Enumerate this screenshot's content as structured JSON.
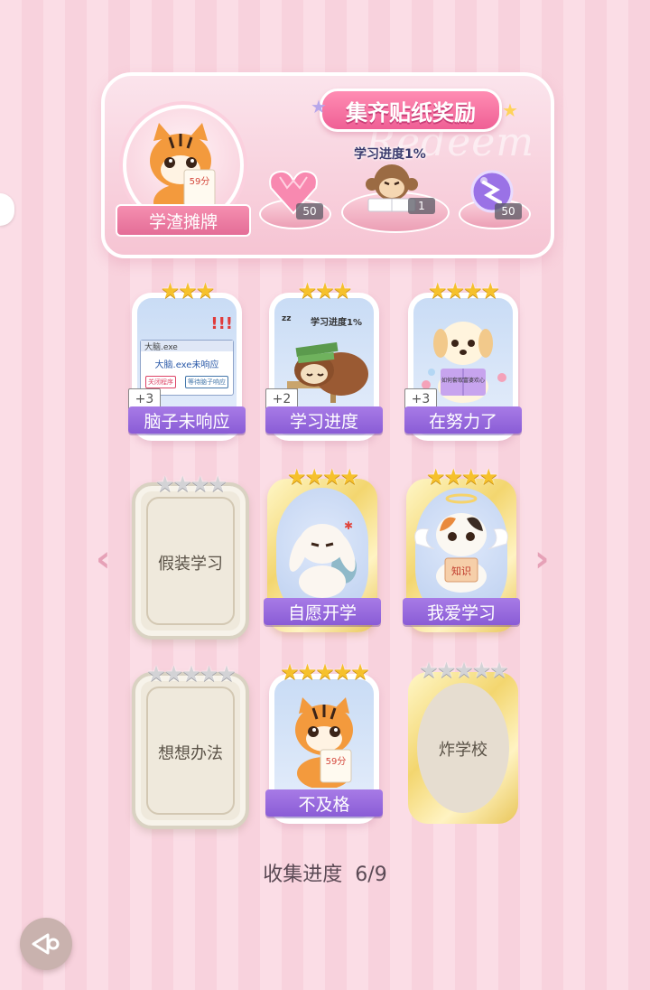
{
  "banner": {
    "title": "集齐贴纸奖励",
    "watermark": "Redeem",
    "avatar_label": "学渣摊牌",
    "avatar_paper": "59分",
    "study_label": "学习进度1%",
    "rewards": [
      {
        "name": "heart-gem",
        "qty": "50"
      },
      {
        "name": "monkey-sticker",
        "qty": "1"
      },
      {
        "name": "purple-orb",
        "qty": "50"
      }
    ]
  },
  "cards": [
    {
      "id": "c1",
      "name": "脑子未响应",
      "stars": 3,
      "filled": 3,
      "bonus": "+3",
      "state": "unlocked",
      "popup_title": "大脑.exe",
      "popup_text": "大脑.exe未响应",
      "popup_btn1": "关闭程序",
      "popup_btn2": "等待脑子响应"
    },
    {
      "id": "c2",
      "name": "学习进度",
      "stars": 3,
      "filled": 3,
      "bonus": "+2",
      "state": "unlocked",
      "bubble": "学习进度1%",
      "zz": "zz"
    },
    {
      "id": "c3",
      "name": "在努力了",
      "stars": 4,
      "filled": 4,
      "bonus": "+3",
      "state": "unlocked",
      "book": "如何套取富婆欢心"
    },
    {
      "id": "c4",
      "name": "假装学习",
      "stars": 4,
      "filled": 0,
      "state": "locked"
    },
    {
      "id": "c5",
      "name": "自愿开学",
      "stars": 4,
      "filled": 4,
      "state": "gold"
    },
    {
      "id": "c6",
      "name": "我爱学习",
      "stars": 4,
      "filled": 4,
      "state": "gold",
      "book": "知识"
    },
    {
      "id": "c7",
      "name": "想想办法",
      "stars": 5,
      "filled": 0,
      "state": "locked"
    },
    {
      "id": "c8",
      "name": "不及格",
      "stars": 5,
      "filled": 5,
      "state": "unlocked",
      "paper": "59分"
    },
    {
      "id": "c9",
      "name": "炸学校",
      "stars": 5,
      "filled": 0,
      "state": "locked-gold"
    }
  ],
  "progress": {
    "label": "收集进度",
    "value": "6/9"
  },
  "colors": {
    "accent": "#8a5cd6",
    "pink": "#ef5f95",
    "gold": "#f6c12c"
  }
}
